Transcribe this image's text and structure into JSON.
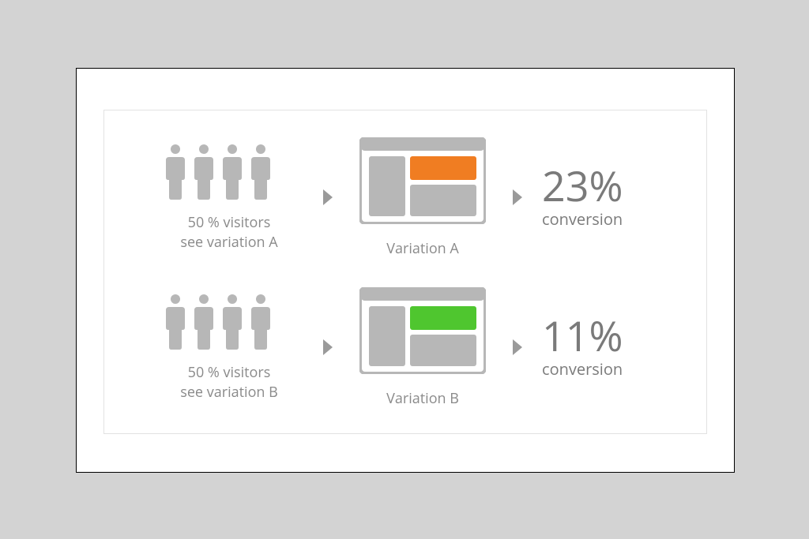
{
  "rows": [
    {
      "visitors_line1": "50 % visitors",
      "visitors_line2": "see variation A",
      "mock_label": "Variation A",
      "accent": "#f07d22",
      "pct": "23%",
      "conv_label": "conversion"
    },
    {
      "visitors_line1": "50 % visitors",
      "visitors_line2": "see variation B",
      "mock_label": "Variation B",
      "accent": "#4fc62f",
      "pct": "11%",
      "conv_label": "conversion"
    }
  ],
  "colors": {
    "grey": "#b7b7b7",
    "text": "#8a8a8a",
    "arrow": "#9a9a9a"
  }
}
